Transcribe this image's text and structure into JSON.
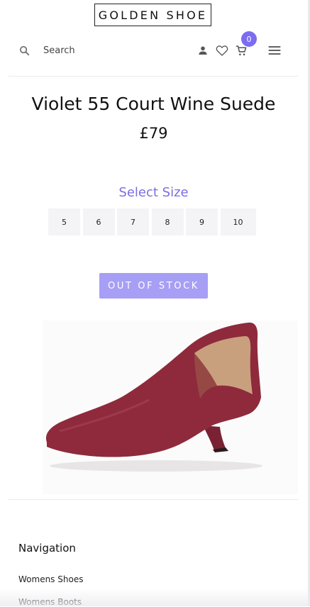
{
  "header": {
    "logo_text": "GOLDEN SHOE",
    "search_label": "Search",
    "cart_count": "0",
    "icons": [
      "search-icon",
      "account-icon",
      "wishlist-heart-icon",
      "cart-icon",
      "menu-icon"
    ]
  },
  "product": {
    "title": "Violet 55 Court Wine Suede",
    "price": "£79",
    "size_heading": "Select Size",
    "sizes": [
      "5",
      "6",
      "7",
      "8",
      "9",
      "10"
    ],
    "stock_button": "OUT OF STOCK",
    "image": "wine-suede-court-shoe"
  },
  "footer": {
    "navigation_title": "Navigation",
    "links": [
      "Womens Shoes",
      "Womens Boots"
    ]
  },
  "colors": {
    "accent": "#7b6cf0",
    "out_of_stock_button": "#a79ef5",
    "shoe_suede": "#8e2a3c"
  }
}
